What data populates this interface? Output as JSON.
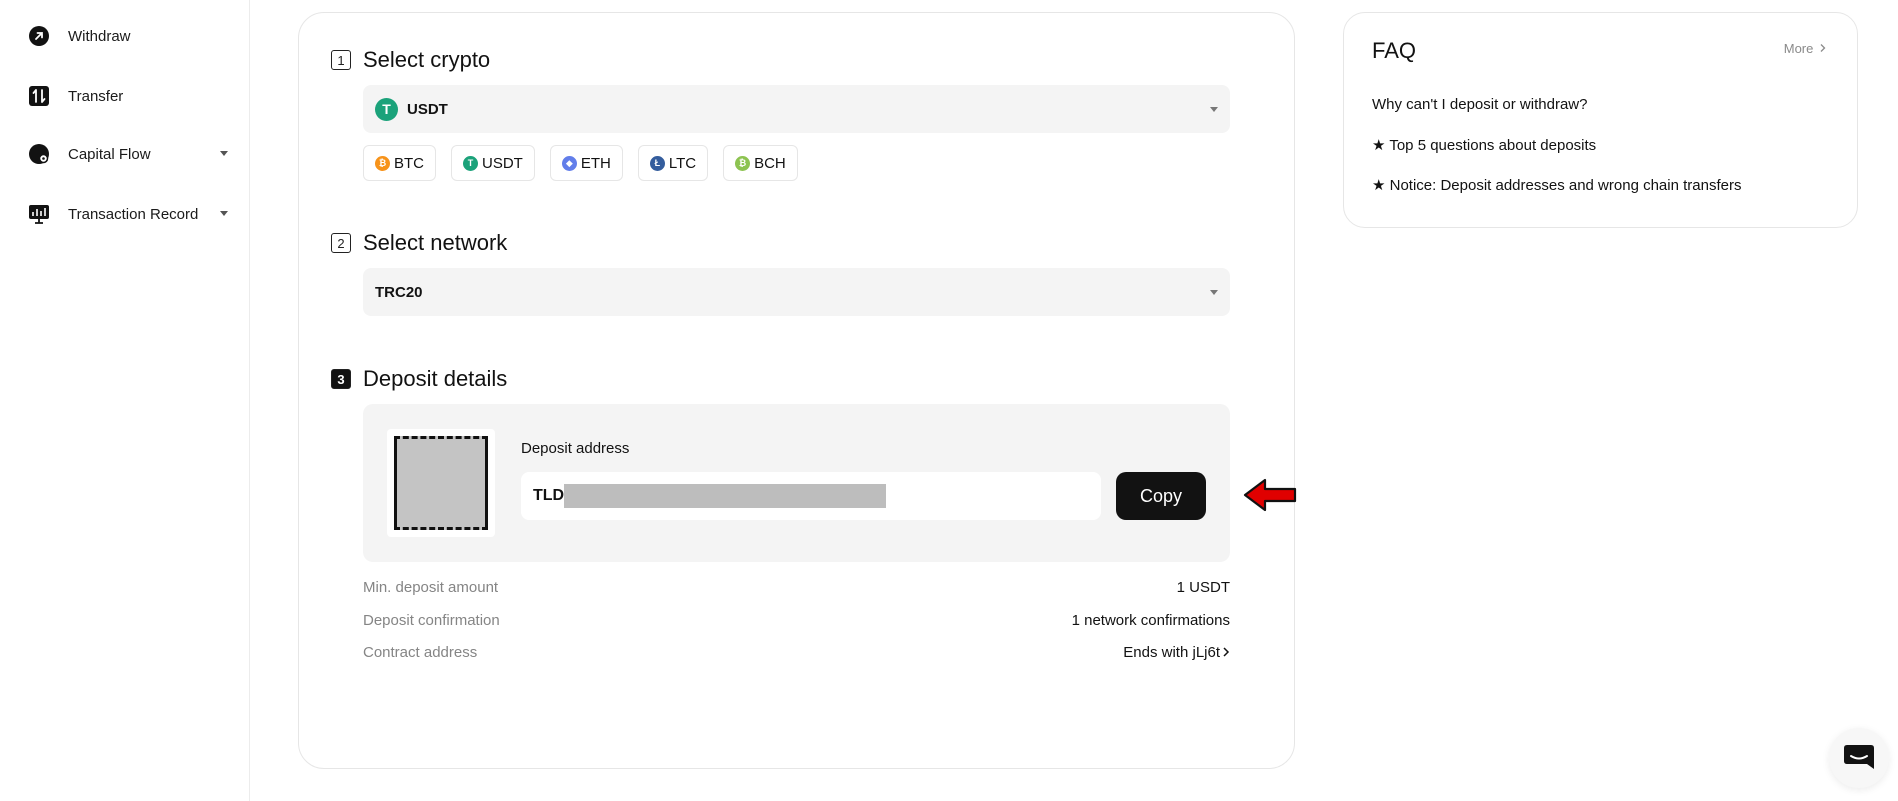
{
  "sidebar": {
    "items": [
      {
        "label": "Withdraw",
        "icon": "withdraw-icon",
        "has_caret": false
      },
      {
        "label": "Transfer",
        "icon": "transfer-icon",
        "has_caret": false
      },
      {
        "label": "Capital Flow",
        "icon": "capital-flow-icon",
        "has_caret": true
      },
      {
        "label": "Transaction Record",
        "icon": "transaction-record-icon",
        "has_caret": true
      }
    ]
  },
  "steps": {
    "crypto": {
      "number": "1",
      "title": "Select crypto",
      "selected": "USDT",
      "selected_icon_glyph": "T"
    },
    "network": {
      "number": "2",
      "title": "Select network",
      "selected": "TRC20"
    },
    "details": {
      "number": "3",
      "title": "Deposit details"
    }
  },
  "coin_chips": [
    {
      "label": "BTC",
      "glyph": "₿",
      "color": "#f7931a"
    },
    {
      "label": "USDT",
      "glyph": "T",
      "color": "#1ba27a"
    },
    {
      "label": "ETH",
      "glyph": "◆",
      "color": "#627eea"
    },
    {
      "label": "LTC",
      "glyph": "Ł",
      "color": "#345d9d"
    },
    {
      "label": "BCH",
      "glyph": "₿",
      "color": "#8dc351"
    }
  ],
  "deposit": {
    "address_label": "Deposit address",
    "address_prefix": "TLD",
    "copy_label": "Copy"
  },
  "info": {
    "min_deposit_label": "Min. deposit amount",
    "min_deposit_value": "1 USDT",
    "confirmation_label": "Deposit confirmation",
    "confirmation_value": "1 network confirmations",
    "contract_label": "Contract address",
    "contract_value": "Ends with jLj6t"
  },
  "faq": {
    "title": "FAQ",
    "more": "More",
    "items": [
      "Why can't I deposit or withdraw?",
      "★ Top 5 questions about deposits",
      "★ Notice: Deposit addresses and wrong chain transfers"
    ]
  },
  "colors": {
    "accent": "#121212",
    "usdt": "#1ba27a",
    "annotation_arrow": "#e00000"
  }
}
